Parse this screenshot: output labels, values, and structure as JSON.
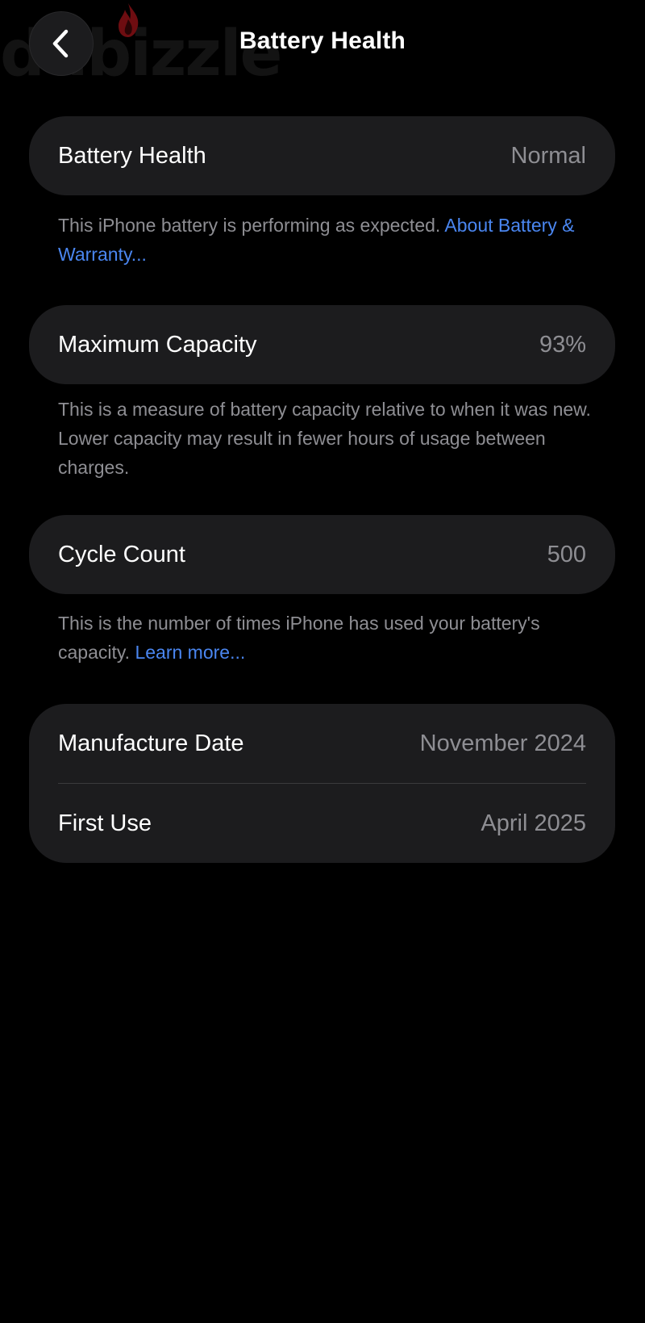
{
  "watermark": "dubizzle",
  "header": {
    "title": "Battery Health"
  },
  "battery_health": {
    "label": "Battery Health",
    "value": "Normal",
    "footnote": "This iPhone battery is performing as expected. ",
    "footnote_link": "About Battery & Warranty..."
  },
  "maximum_capacity": {
    "label": "Maximum Capacity",
    "value": "93%",
    "footnote": "This is a measure of battery capacity relative to when it was new. Lower capacity may result in fewer hours of usage between charges."
  },
  "cycle_count": {
    "label": "Cycle Count",
    "value": "500",
    "footnote": "This is the number of times iPhone has used your battery's capacity. ",
    "footnote_link": "Learn more..."
  },
  "dates": {
    "manufacture_label": "Manufacture Date",
    "manufacture_value": "November 2024",
    "first_use_label": "First Use",
    "first_use_value": "April 2025"
  },
  "icons": {
    "back": "chevron-left-icon"
  },
  "colors": {
    "background": "#000000",
    "card": "#1c1c1e",
    "secondary_text": "#8e8e93",
    "link": "#4a86f0",
    "watermark_flame": "#b8161c"
  }
}
